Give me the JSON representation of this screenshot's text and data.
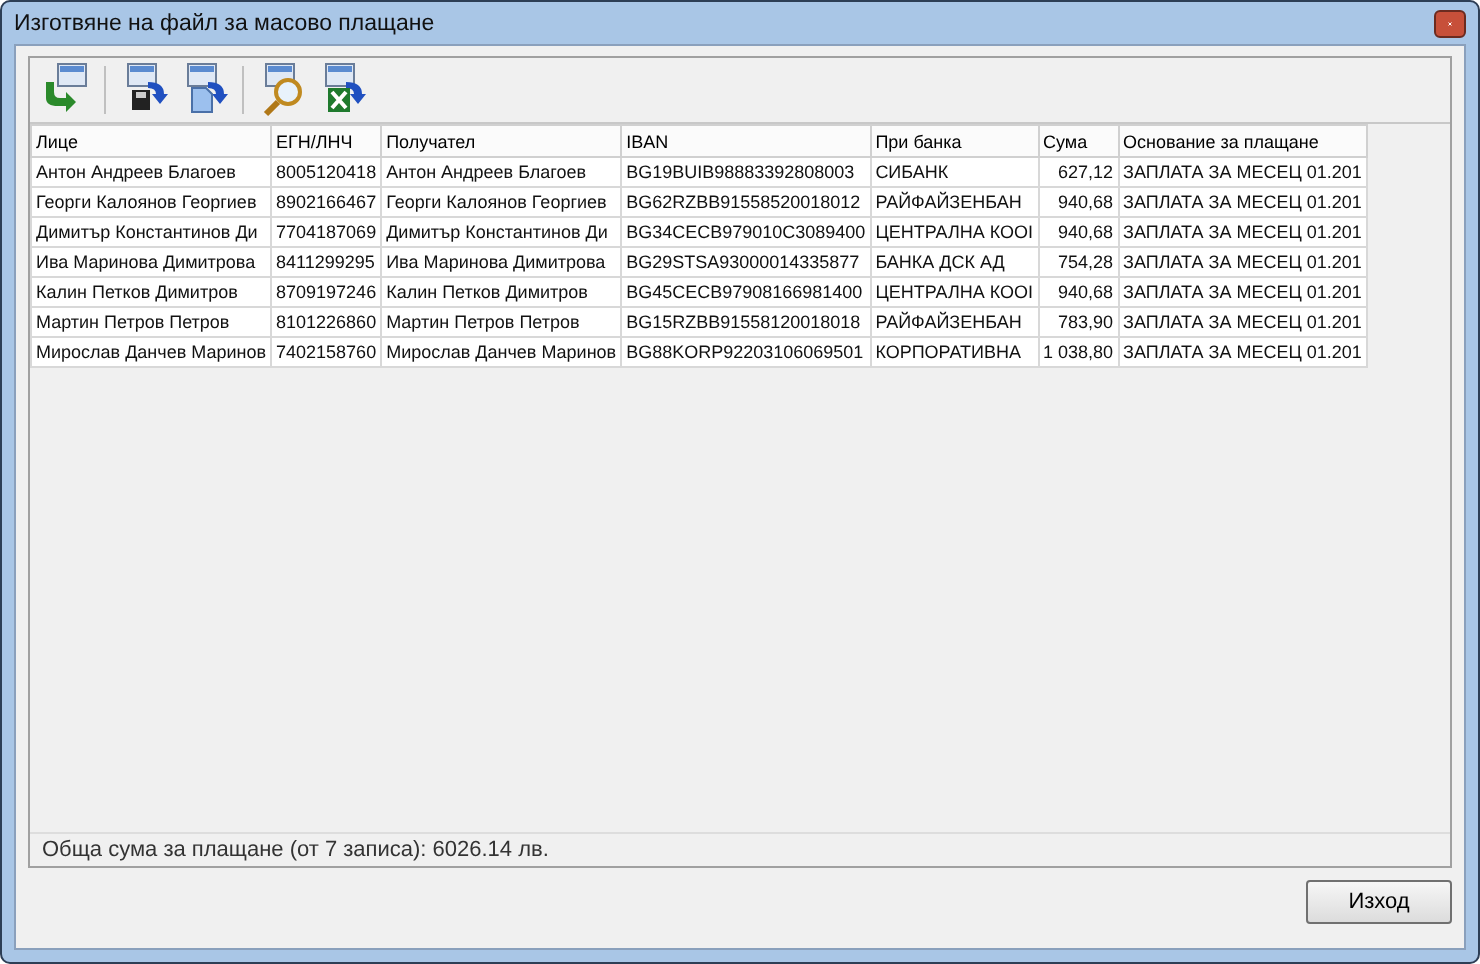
{
  "window": {
    "title": "Изготвяне на файл за масово плащане"
  },
  "toolbar": [
    {
      "kind": "back"
    },
    {
      "kind": "save"
    },
    {
      "kind": "copy"
    },
    {
      "kind": "preview"
    },
    {
      "kind": "excel"
    }
  ],
  "table": {
    "columns": [
      "Лице",
      "ЕГН/ЛНЧ",
      "Получател",
      "IBAN",
      "При банка",
      "Сума",
      "Основание за плащане"
    ],
    "rows": [
      [
        "Антон Андреев Благоев",
        "8005120418",
        "Антон Андреев Благоев",
        "BG19BUIB98883392808003",
        "СИБАНК",
        "627,12",
        "ЗАПЛАТА ЗА МЕСЕЦ 01.201"
      ],
      [
        "Георги Калоянов Георгиев",
        "8902166467",
        "Георги Калоянов Георгиев",
        "BG62RZBB91558520018012",
        "РАЙФАЙЗЕНБАН",
        "940,68",
        "ЗАПЛАТА ЗА МЕСЕЦ 01.201"
      ],
      [
        "Димитър Константинов Ди",
        "7704187069",
        "Димитър Константинов Ди",
        "BG34CECB979010C3089400",
        "ЦЕНТРАЛНА КООI",
        "940,68",
        "ЗАПЛАТА ЗА МЕСЕЦ 01.201"
      ],
      [
        "Ива Маринова Димитрова",
        "8411299295",
        "Ива Маринова Димитрова",
        "BG29STSA93000014335877",
        "БАНКА ДСК АД",
        "754,28",
        "ЗАПЛАТА ЗА МЕСЕЦ 01.201"
      ],
      [
        "Калин Петков Димитров",
        "8709197246",
        "Калин Петков Димитров",
        "BG45CECB97908166981400",
        "ЦЕНТРАЛНА КООI",
        "940,68",
        "ЗАПЛАТА ЗА МЕСЕЦ 01.201"
      ],
      [
        "Мартин Петров Петров",
        "8101226860",
        "Мартин Петров Петров",
        "BG15RZBB91558120018018",
        "РАЙФАЙЗЕНБАН",
        "783,90",
        "ЗАПЛАТА ЗА МЕСЕЦ 01.201"
      ],
      [
        "Мирослав Данчев Маринов",
        "7402158760",
        "Мирослав Данчев Маринов",
        "BG88KORP92203106069501",
        "КОРПОРАТИВНА",
        "1 038,80",
        "ЗАПЛАТА ЗА МЕСЕЦ 01.201"
      ]
    ]
  },
  "status_bar": "Обща сума за плащане (от 7 записа): 6026.14 лв.",
  "buttons": [
    "Изход"
  ]
}
